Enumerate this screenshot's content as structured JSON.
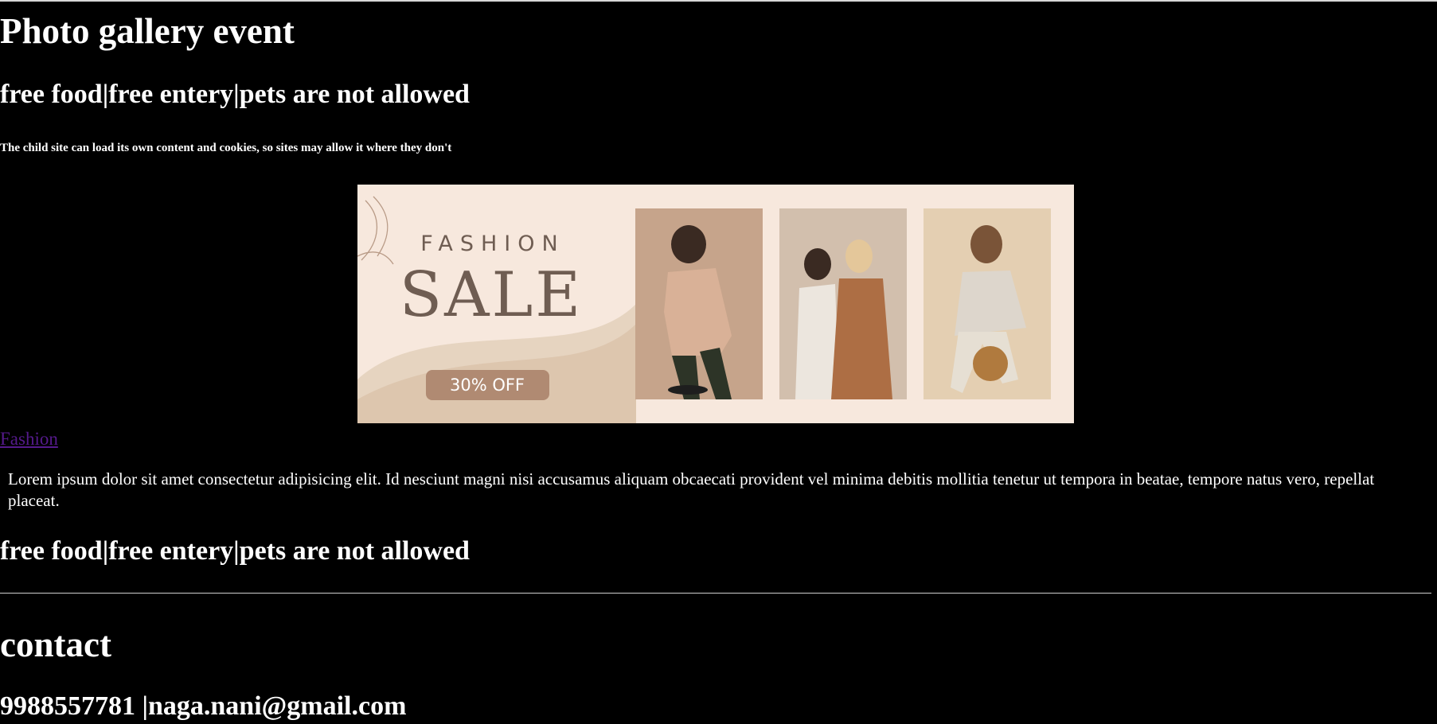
{
  "page": {
    "title": "Photo gallery event",
    "subtitle": "free food|free entery|pets are not allowed",
    "note": "The child site can load its own content and cookies, so sites may allow it where they don't",
    "banner": {
      "brand_line": "FASHION",
      "headline": "SALE",
      "discount": "30% OFF",
      "caption_link": "Fashion"
    },
    "body_text": "Lorem ipsum dolor sit amet consectetur adipisicing elit. Id nesciunt magni nisi accusamus aliquam obcaecati provident vel minima debitis mollitia tenetur ut tempora in beatae, tempore natus vero, repellat placeat.",
    "subtitle_repeat": "free food|free entery|pets are not allowed",
    "contact": {
      "heading": "contact",
      "details": "9988557781 |naga.nani@gmail.com"
    }
  },
  "colors": {
    "background": "#000000",
    "text": "#ffffff",
    "link": "#551a8b",
    "banner_bg": "#f7e8dd",
    "banner_accent": "#b08a72"
  }
}
